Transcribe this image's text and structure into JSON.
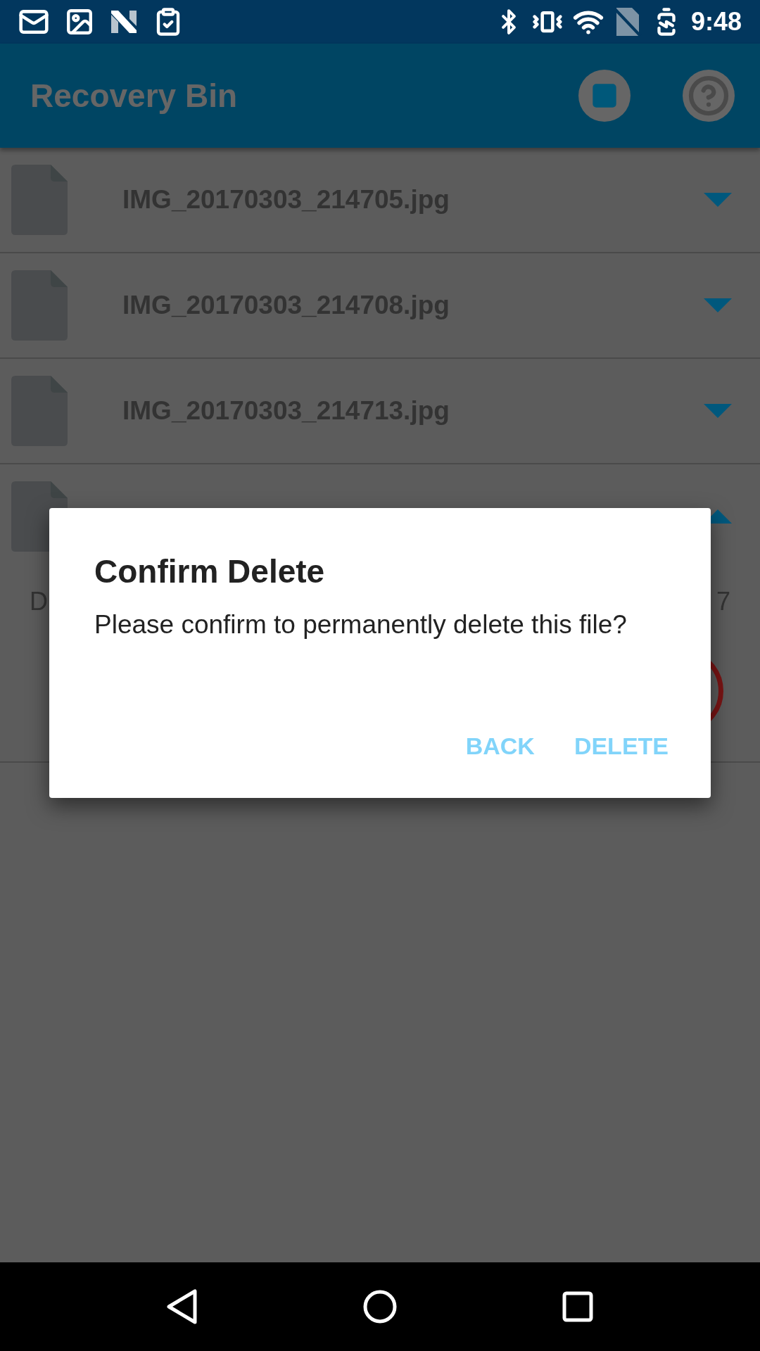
{
  "status_bar": {
    "time": "9:48"
  },
  "app_bar": {
    "title": "Recovery Bin"
  },
  "files": [
    {
      "name": "IMG_20170303_214705.jpg",
      "expanded": false
    },
    {
      "name": "IMG_20170303_214708.jpg",
      "expanded": false
    },
    {
      "name": "IMG_20170303_214713.jpg",
      "expanded": false
    },
    {
      "expanded": true,
      "details": {
        "left_text": "D",
        "right_text": "7"
      }
    }
  ],
  "dialog": {
    "title": "Confirm Delete",
    "message": "Please confirm to permanently delete this file?",
    "buttons": [
      "BACK",
      "DELETE"
    ]
  }
}
